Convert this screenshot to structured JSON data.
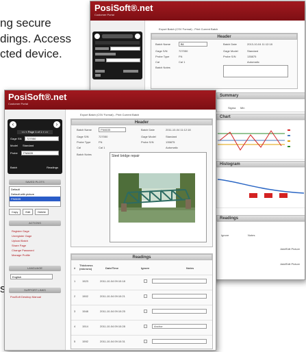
{
  "background_text": {
    "line1": "ng secure",
    "line2": "dings. Access",
    "line3": "cted device.",
    "fragment": "s,"
  },
  "back_window": {
    "brand": "PosiSoft®.net",
    "subtitle": "Customer Portal",
    "crumbs": "Export Batch (CSV Format)  -  Print Current Batch",
    "header_title": "Header",
    "fields": [
      {
        "label": "Batch Name",
        "value": "B1"
      },
      {
        "label": "Batch Date",
        "value": "2013-10-04 11:12:18"
      },
      {
        "label": "Gage S/N",
        "value": "727050"
      },
      {
        "label": "Gage Model",
        "value": "Standard"
      },
      {
        "label": "Probe Type",
        "value": "FN"
      },
      {
        "label": "Probe S/N",
        "value": "135875"
      },
      {
        "label": "Cal",
        "value": "Cal 1"
      },
      {
        "label": "",
        "value": "Automatic"
      },
      {
        "label": "Batch Notes",
        "value": ""
      }
    ],
    "summary_title": "Summary",
    "summary_cols": [
      "Sigma",
      "Min"
    ],
    "chart_title": "Chart",
    "histogram_title": "Histogram",
    "readings_title": "Readings",
    "readings_cols": [
      "Ignore",
      "Notes"
    ],
    "add_picture": "Add/Edit Picture"
  },
  "front_window": {
    "brand": "PosiSoft®.net",
    "subtitle": "Customer Portal",
    "crumbs": "Export Batch (CSV Format)  -  Print Current Batch",
    "nav": {
      "prev": "‹",
      "next": "›",
      "label": "<< « Page 1 of 1 » >>",
      "gage_label": "Gage SN",
      "gage_value": "727050",
      "model_label": "Model",
      "model_value": "Standard",
      "probe_label": "Probe",
      "probe_value": "FN6635",
      "batch_label": "Batch",
      "readings_label": "Readings"
    },
    "saved_title": "SAVED PLOTS",
    "saved_items": [
      "Default",
      "Default with picture",
      "FN6635"
    ],
    "saved_buttons": [
      "Copy",
      "Edit",
      "Delete"
    ],
    "actions_title": "ACTIONS",
    "actions": [
      "Register Gage",
      "Unregister Gage",
      "Upload Batch",
      "Share Page",
      "Change Password",
      "Manage Profile"
    ],
    "language_title": "LANGUAGE",
    "language_value": "English",
    "support_title": "SUPPORT LINKS",
    "support_link": "PosiSoft Desktop Manual",
    "header_title": "Header",
    "fields_left": [
      {
        "label": "Batch Name",
        "value": "FN6635"
      },
      {
        "label": "Gage S/N",
        "value": "727050"
      },
      {
        "label": "Probe Type",
        "value": "FN"
      },
      {
        "label": "Cal",
        "value": "Cal 1"
      }
    ],
    "fields_right": [
      {
        "label": "Batch Date",
        "value": "2011-10-04 11:12:18"
      },
      {
        "label": "Gage Model",
        "value": "Standard"
      },
      {
        "label": "Probe S/N",
        "value": "135875"
      },
      {
        "label": "",
        "value": "Automatic"
      }
    ],
    "notes_label": "Batch Notes",
    "notes_value": "Steel bridge repair",
    "readings_title": "Readings",
    "readings_cols": [
      "#",
      "Thickness (microns)",
      "Date/Time",
      "Ignore",
      "Notes"
    ],
    "readings_rows": [
      {
        "n": "1",
        "t": "1523",
        "d": "2011-10-04 09:10:18",
        "note": ""
      },
      {
        "n": "2",
        "t": "1502",
        "d": "2011-10-04 09:10:21",
        "note": ""
      },
      {
        "n": "3",
        "t": "1548",
        "d": "2011-10-04 09:10:25",
        "note": ""
      },
      {
        "n": "4",
        "t": "1514",
        "d": "2011-10-04 09:10:28",
        "note": "Anchor"
      },
      {
        "n": "5",
        "t": "1592",
        "d": "2011-10-04 09:10:31",
        "note": ""
      }
    ]
  }
}
